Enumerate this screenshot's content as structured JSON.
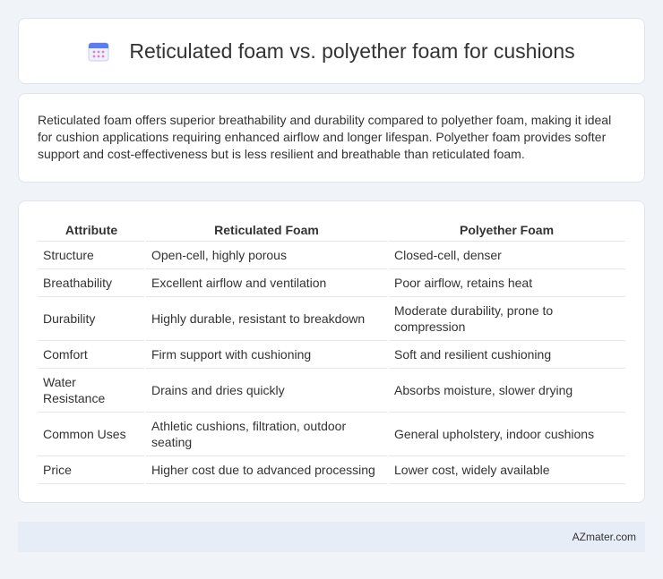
{
  "header": {
    "title": "Reticulated foam vs. polyether foam for cushions",
    "icon": "calendar-icon"
  },
  "summary": {
    "text": "Reticulated foam offers superior breathability and durability compared to polyether foam, making it ideal for cushion applications requiring enhanced airflow and longer lifespan. Polyether foam provides softer support and cost-effectiveness but is less resilient and breathable than reticulated foam."
  },
  "table": {
    "headers": [
      "Attribute",
      "Reticulated Foam",
      "Polyether Foam"
    ],
    "rows": [
      [
        "Structure",
        "Open-cell, highly porous",
        "Closed-cell, denser"
      ],
      [
        "Breathability",
        "Excellent airflow and ventilation",
        "Poor airflow, retains heat"
      ],
      [
        "Durability",
        "Highly durable, resistant to breakdown",
        "Moderate durability, prone to compression"
      ],
      [
        "Comfort",
        "Firm support with cushioning",
        "Soft and resilient cushioning"
      ],
      [
        "Water Resistance",
        "Drains and dries quickly",
        "Absorbs moisture, slower drying"
      ],
      [
        "Common Uses",
        "Athletic cushions, filtration, outdoor seating",
        "General upholstery, indoor cushions"
      ],
      [
        "Price",
        "Higher cost due to advanced processing",
        "Lower cost, widely available"
      ]
    ],
    "row_heights": [
      1,
      1,
      2,
      1,
      2,
      2,
      1
    ]
  },
  "footer": {
    "brand": "AZmater.com"
  }
}
